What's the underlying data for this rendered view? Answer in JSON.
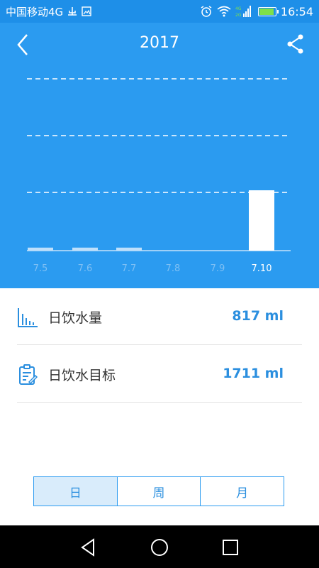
{
  "status_bar": {
    "carrier": "中国移动4G",
    "time": "16:54",
    "colors": {
      "battery_fill": "#7ee04a"
    }
  },
  "header": {
    "title": "2017",
    "back_icon": "chevron-left-icon",
    "share_icon": "share-icon"
  },
  "chart_data": {
    "type": "bar",
    "categories": [
      "7.5",
      "7.6",
      "7.7",
      "7.8",
      "7.9",
      "7.10"
    ],
    "values": [
      0.05,
      0.05,
      0.05,
      0,
      0,
      1.0
    ],
    "selected_index": 5,
    "grid": true,
    "grid_style": "dashed",
    "colors": {
      "bar": "#ffffff",
      "background": "#2b9bf0"
    }
  },
  "info": {
    "daily_intake": {
      "label": "日饮水量",
      "value": "817 ml",
      "icon": "bar-chart-icon"
    },
    "daily_goal": {
      "label": "日饮水目标",
      "value": "1711 ml",
      "icon": "clipboard-icon"
    }
  },
  "tabs": [
    {
      "label": "日",
      "active": true
    },
    {
      "label": "周",
      "active": false
    },
    {
      "label": "月",
      "active": false
    }
  ],
  "colors": {
    "primary": "#2b9bf0",
    "accent_text": "#2b8fdf",
    "tab_active_bg": "#d9ecfb"
  }
}
